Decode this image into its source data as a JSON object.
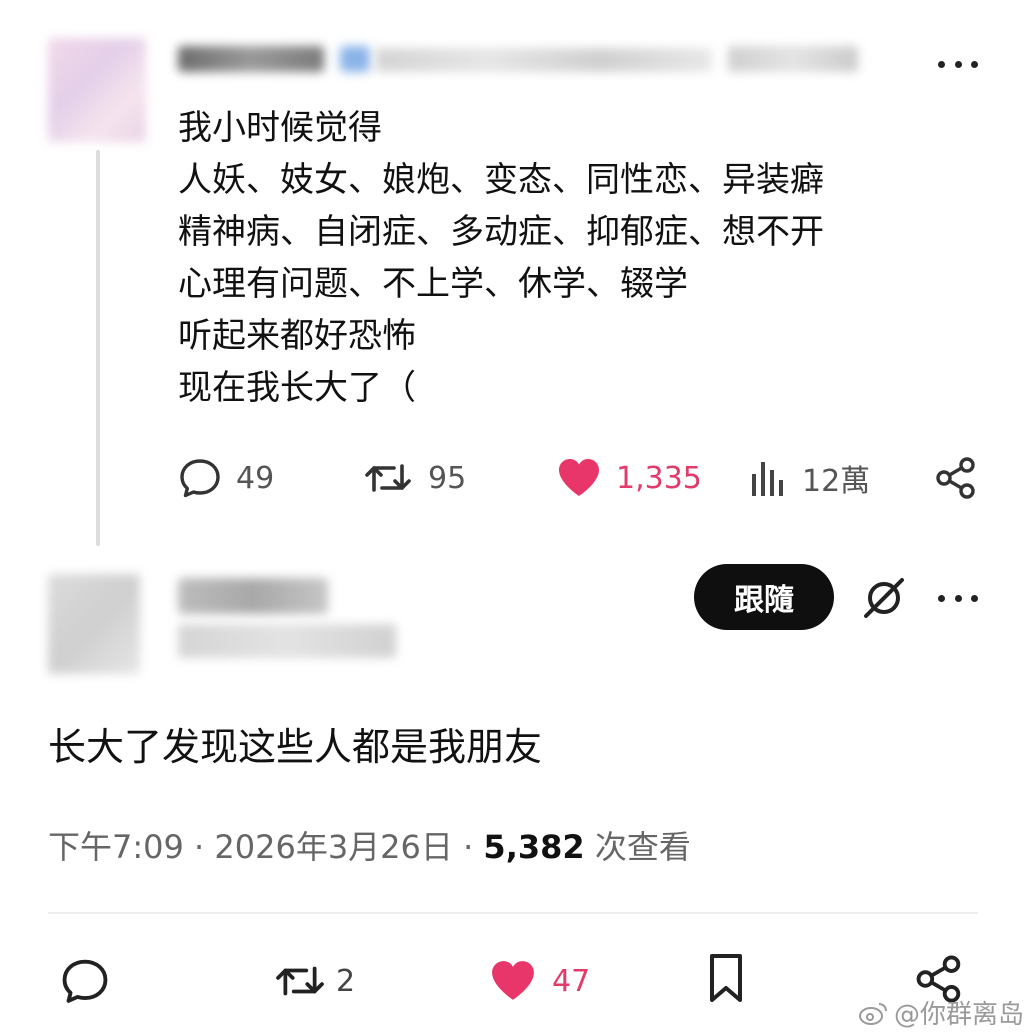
{
  "post": {
    "lines": [
      "我小时候觉得",
      "人妖、妓女、娘炮、变态、同性恋、异装癖",
      "精神病、自闭症、多动症、抑郁症、想不开",
      "心理有问题、不上学、休学、辍学",
      "听起来都好恐怖",
      "现在我长大了（"
    ],
    "stats": {
      "replies": "49",
      "reposts": "95",
      "likes": "1,335",
      "views": "12萬"
    }
  },
  "reply": {
    "follow_label": "跟隨",
    "text": "长大了发现这些人都是我朋友",
    "meta_prefix": "下午7:09 · 2026年3月26日 · ",
    "views_count": "5,382",
    "views_suffix": " 次查看",
    "stats": {
      "reposts": "2",
      "likes": "47"
    }
  },
  "watermark": "@你群离岛",
  "colors": {
    "like_pink": "#e23b6a",
    "follow_bg": "#0f0f0f"
  }
}
